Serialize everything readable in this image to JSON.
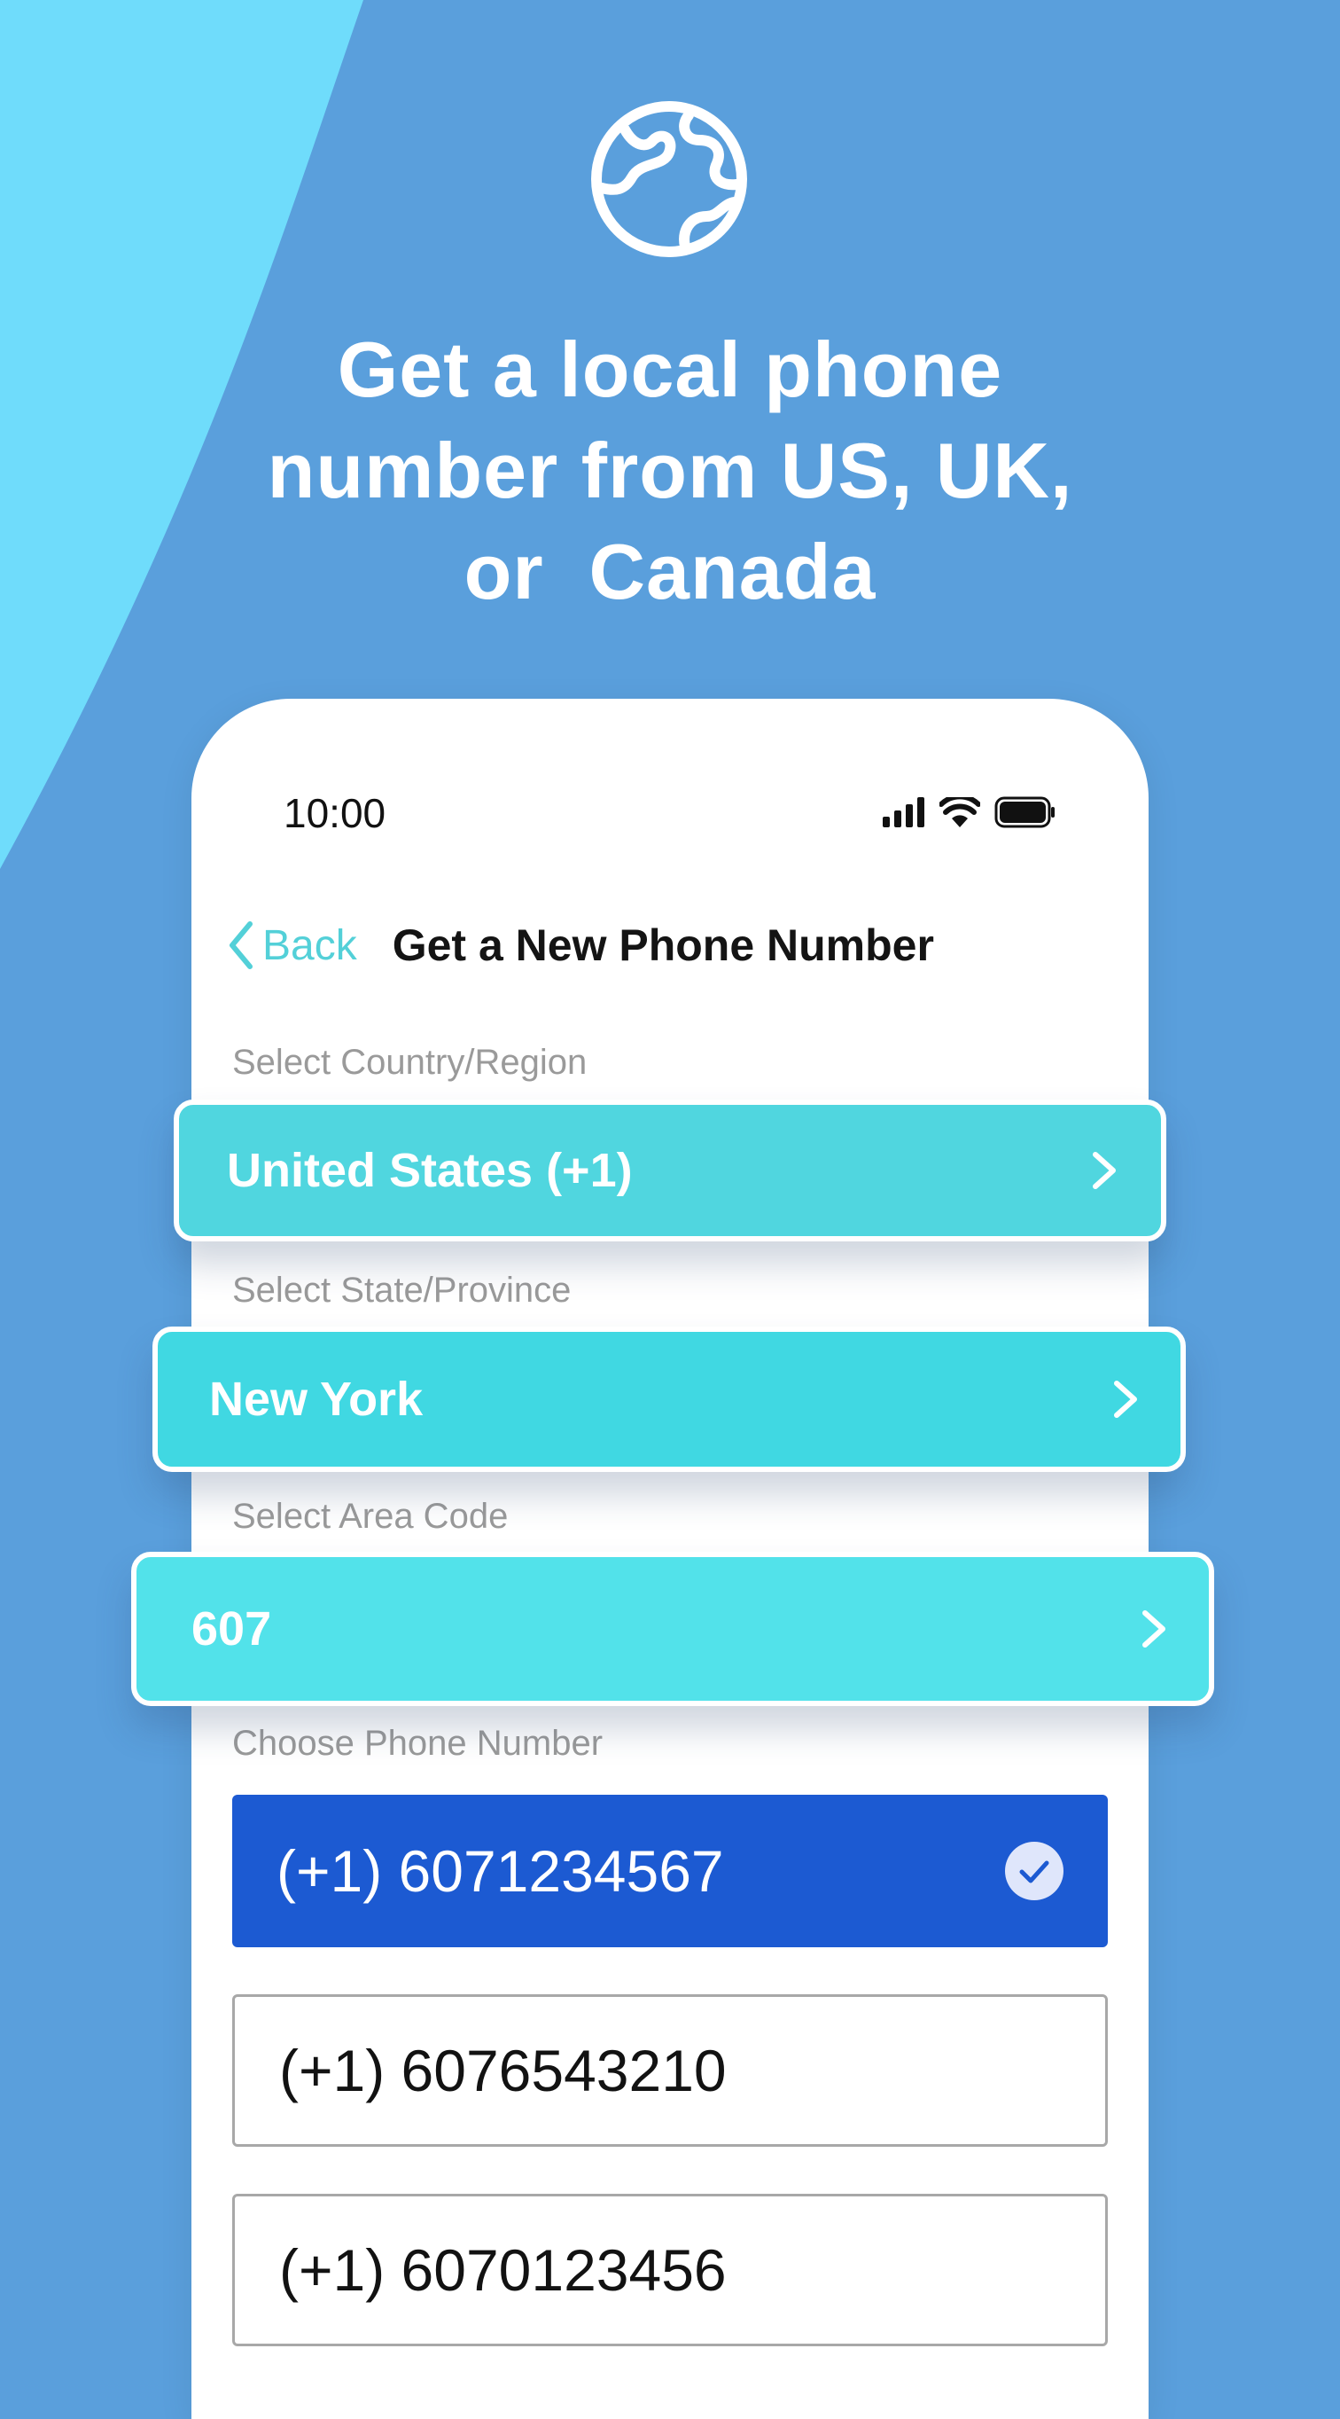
{
  "headline": {
    "line1": "Get a local phone",
    "line2": "number from US, UK,",
    "line3": "or  Canada"
  },
  "status_bar": {
    "time": "10:00"
  },
  "nav": {
    "back_label": "Back",
    "title": "Get a New Phone Number"
  },
  "country": {
    "label": "Select Country/Region",
    "value": "United States (+1)"
  },
  "state": {
    "label": "Select State/Province",
    "value": "New York"
  },
  "area_code": {
    "label": "Select Area Code",
    "value": "607"
  },
  "phone_numbers": {
    "label": "Choose Phone Number",
    "options": [
      {
        "number": "(+1) 6071234567",
        "selected": true
      },
      {
        "number": "(+1) 6076543210",
        "selected": false
      },
      {
        "number": "(+1) 6070123456",
        "selected": false
      }
    ]
  },
  "colors": {
    "background": "#5a9fdc",
    "curve": "#6fdcfb",
    "accent_teal": "#53d0d8",
    "selected_blue": "#1c5ad2"
  },
  "icons": [
    "globe-icon",
    "signal-icon",
    "wifi-icon",
    "battery-icon",
    "back-chevron-icon",
    "chevron-right-icon",
    "check-circle-icon"
  ]
}
